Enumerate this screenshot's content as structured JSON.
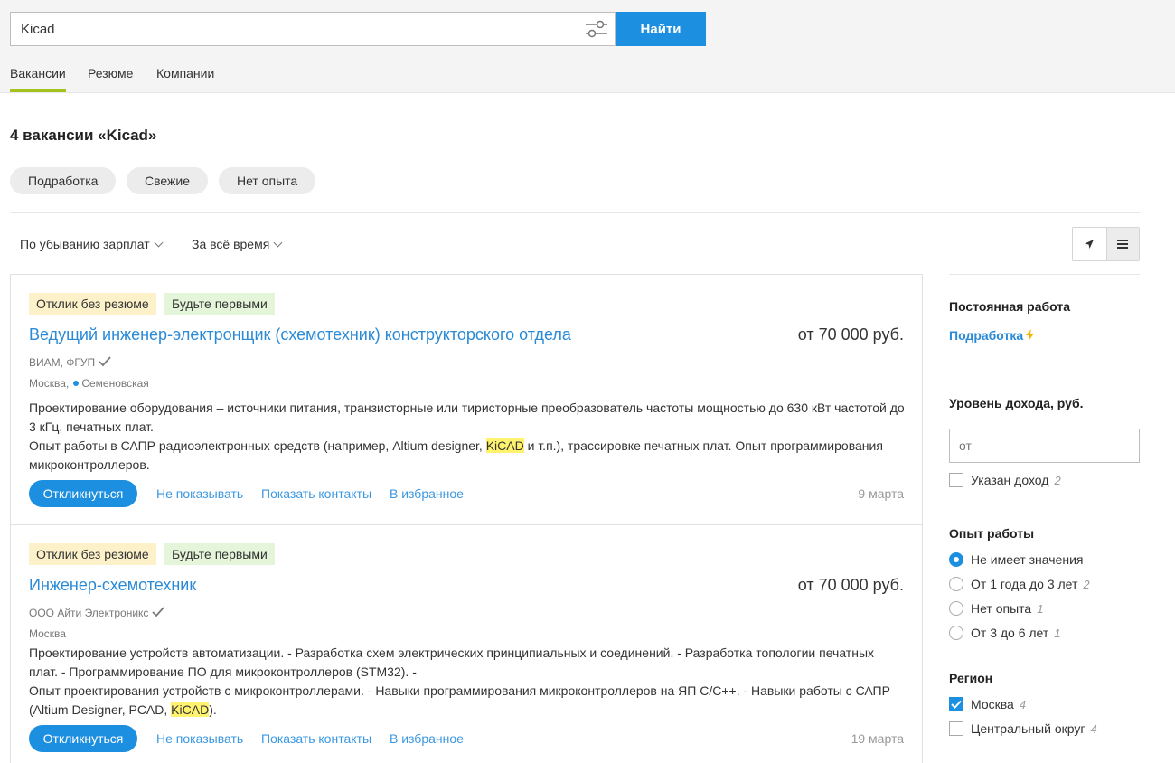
{
  "search": {
    "value": "Kicad",
    "button_label": "Найти"
  },
  "tabs": [
    {
      "label": "Вакансии",
      "active": true
    },
    {
      "label": "Резюме",
      "active": false
    },
    {
      "label": "Компании",
      "active": false
    }
  ],
  "results_title": "4 вакансии «Kicad»",
  "quick_filters": [
    "Подработка",
    "Свежие",
    "Нет опыта"
  ],
  "sort": {
    "order": "По убыванию зарплат",
    "period": "За всё время"
  },
  "vacancies": [
    {
      "badges": [
        "Отклик без резюме",
        "Будьте первыми"
      ],
      "title": "Ведущий инженер-электронщик (схемотехник) конструкторского отдела",
      "salary": "от 70 000 руб.",
      "company": "ВИАМ, ФГУП",
      "city": "Москва,",
      "metro": "Семеновская",
      "desc1": "Проектирование оборудования – источники питания, транзисторные или тиристорные преобразователь частоты мощностью до 630 кВт частотой до 3 кГц, печатных плат.",
      "desc2_before": "Опыт работы в САПР радиоэлектронных средств (например, Altium designer, ",
      "desc2_highlight": "KiCAD",
      "desc2_after": " и т.п.), трассировке печатных плат. Опыт программирования микроконтроллеров.",
      "apply": "Откликнуться",
      "hide": "Не показывать",
      "contacts": "Показать контакты",
      "favorite": "В избранное",
      "date": "9 марта"
    },
    {
      "badges": [
        "Отклик без резюме",
        "Будьте первыми"
      ],
      "title": "Инженер-схемотехник",
      "salary": "от 70 000 руб.",
      "company": "ООО Айти Электроникс",
      "city": "Москва",
      "metro": "",
      "desc1": "Проектирование устройств автоматизации. - Разработка схем электрических принципиальных и соединений. - Разработка топологии печатных плат. - Программирование ПО для микроконтроллеров (STM32). -",
      "desc2_before": "Опыт проектирования устройств с микроконтроллерами. - Навыки программирования микроконтроллеров на ЯП C/C++. - Навыки работы с САПР (Altium Designer, PCAD, ",
      "desc2_highlight": "KiCAD",
      "desc2_after": ").",
      "apply": "Откликнуться",
      "hide": "Не показывать",
      "contacts": "Показать контакты",
      "favorite": "В избранное",
      "date": "19 марта"
    }
  ],
  "sidebar": {
    "employment_title": "Постоянная работа",
    "employment_link": "Подработка",
    "income_title": "Уровень дохода, руб.",
    "income_placeholder": "от",
    "income_specified": {
      "label": "Указан доход",
      "count": "2",
      "checked": false
    },
    "experience_title": "Опыт работы",
    "experience_options": [
      {
        "label": "Не имеет значения",
        "count": "",
        "checked": true
      },
      {
        "label": "От 1 года до 3 лет",
        "count": "2",
        "checked": false
      },
      {
        "label": "Нет опыта",
        "count": "1",
        "checked": false
      },
      {
        "label": "От 3 до 6 лет",
        "count": "1",
        "checked": false
      }
    ],
    "region_title": "Регион",
    "region_options": [
      {
        "label": "Москва",
        "count": "4",
        "checked": true
      },
      {
        "label": "Центральный округ",
        "count": "4",
        "checked": false
      }
    ]
  },
  "colors": {
    "accent": "#1d8fe1",
    "link": "#2a8ad6",
    "tab_underline": "#a3c41f",
    "highlight": "#fff26e"
  }
}
